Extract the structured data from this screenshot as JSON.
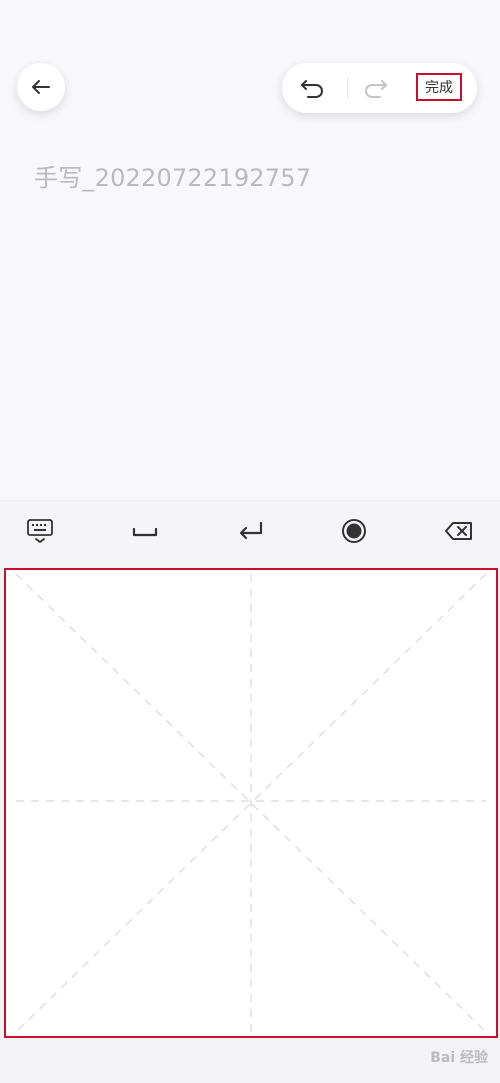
{
  "header": {
    "back_icon": "back-arrow-icon",
    "undo_icon": "undo-icon",
    "redo_icon": "redo-icon",
    "done_label": "完成"
  },
  "document": {
    "title": "手写_20220722192757"
  },
  "keyboard_bar": {
    "items": [
      {
        "name": "keyboard-hide-icon"
      },
      {
        "name": "space-icon"
      },
      {
        "name": "enter-icon"
      },
      {
        "name": "brush-icon"
      },
      {
        "name": "backspace-icon"
      }
    ]
  },
  "colors": {
    "highlight": "#c8102e",
    "title_gray": "#b9b9bf",
    "background": "#f8f7fb"
  },
  "watermark": "Bai 经验"
}
